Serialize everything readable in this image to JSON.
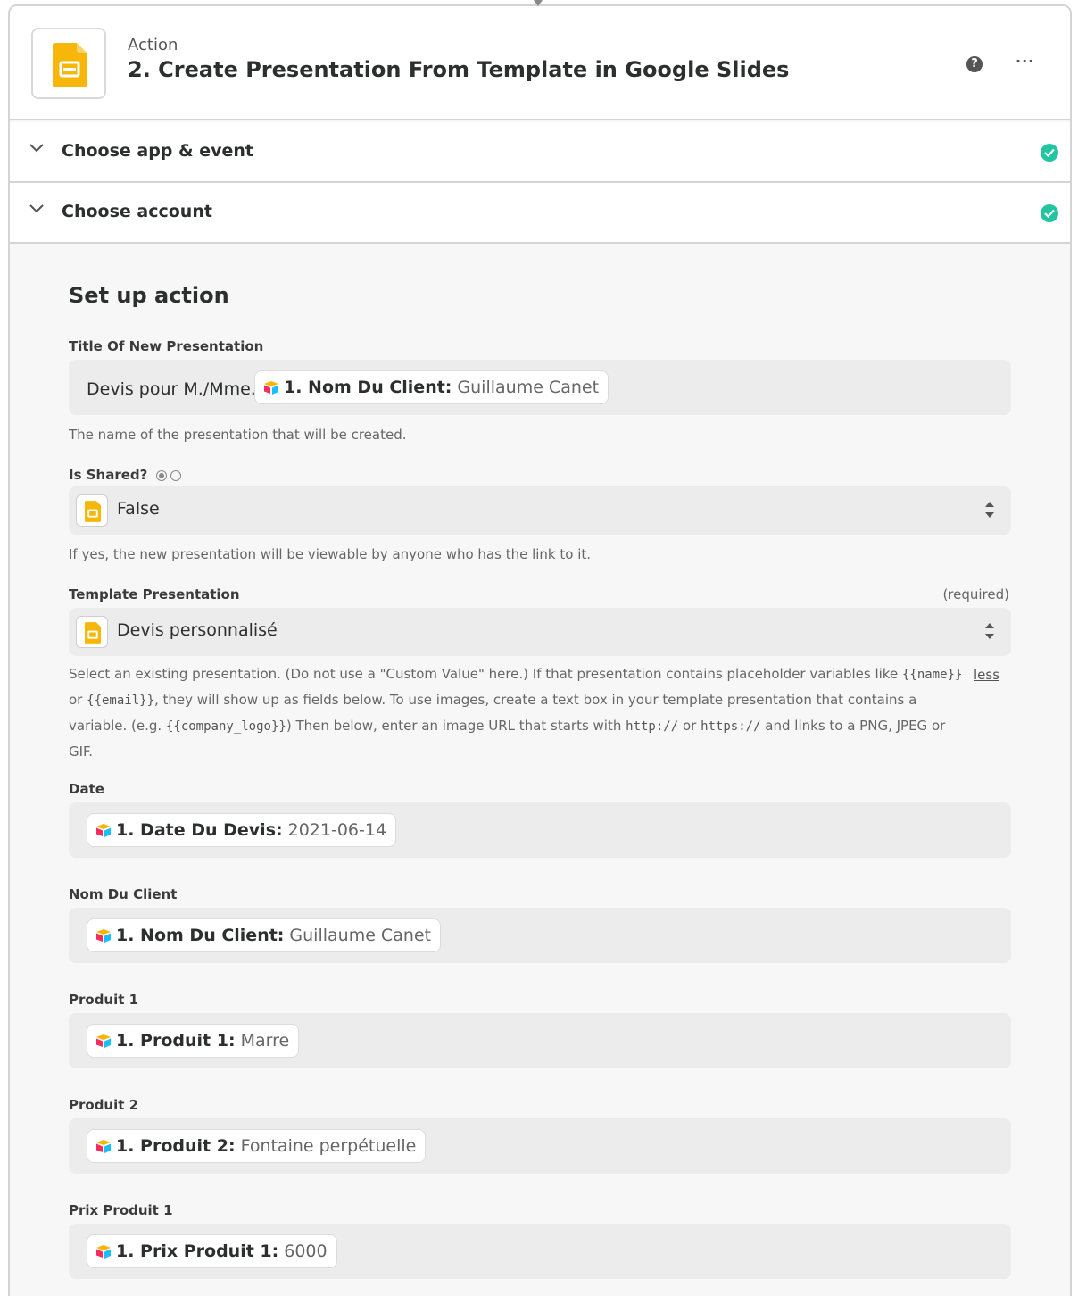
{
  "header": {
    "kicker": "Action",
    "title": "2. Create Presentation From Template in Google Slides",
    "app_icon": "google-slides-icon",
    "help_icon": "question-icon",
    "more_icon": "ellipsis-icon"
  },
  "sections": [
    {
      "label": "Choose app & event",
      "status": "complete"
    },
    {
      "label": "Choose account",
      "status": "complete"
    }
  ],
  "setup": {
    "title": "Set up action",
    "title_field": {
      "label": "Title Of New Presentation",
      "prefix": "Devis pour M./Mme.",
      "pill": {
        "key": "1. Nom Du Client:",
        "value": "Guillaume Canet"
      },
      "help": "The name of the presentation that will be created."
    },
    "is_shared": {
      "label": "Is Shared?",
      "value": "False",
      "help": "If yes, the new presentation will be viewable by anyone who has the link to it."
    },
    "template": {
      "label": "Template Presentation",
      "required": "(required)",
      "value": "Devis personnalisé",
      "help_1": "Select an existing presentation. (Do not use a \"Custom Value\" here.) If that presentation contains placeholder variables like",
      "code_name": "{{name}}",
      "help_2": "or",
      "code_email": "{{email}}",
      "help_3": ", they will show up as fields below. To use images, create a text box in your template presentation that contains a variable. (e.g.",
      "code_logo": "{{company_logo}}",
      "help_4": ") Then below, enter an image URL that starts with",
      "code_http": "http://",
      "help_5": "or",
      "code_https": "https://",
      "help_6": "and links to a PNG, JPEG or GIF.",
      "less": "less"
    },
    "fields": [
      {
        "label": "Date",
        "key": "1. Date Du Devis:",
        "value": "2021-06-14"
      },
      {
        "label": "Nom Du Client",
        "key": "1. Nom Du Client:",
        "value": "Guillaume Canet"
      },
      {
        "label": "Produit 1",
        "key": "1. Produit 1:",
        "value": "Marre"
      },
      {
        "label": "Produit 2",
        "key": "1. Produit 2:",
        "value": "Fontaine perpétuelle"
      },
      {
        "label": "Prix Produit 1",
        "key": "1. Prix Produit 1:",
        "value": "6000"
      }
    ]
  },
  "colors": {
    "success": "#22c4a1",
    "slides_yellow": "#f6b70a",
    "field_bg": "#ececec"
  }
}
